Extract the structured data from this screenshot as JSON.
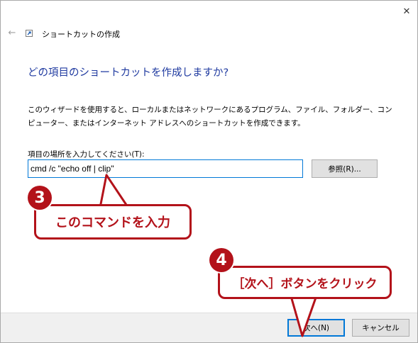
{
  "window": {
    "title": "ショートカットの作成",
    "close_glyph": "✕",
    "back_glyph": "←"
  },
  "wizard": {
    "heading": "どの項目のショートカットを作成しますか?",
    "description": "このウィザードを使用すると、ローカルまたはネットワークにあるプログラム、ファイル、フォルダー、コンピューター、またはインターネット アドレスへのショートカットを作成できます。",
    "field_label": "項目の場所を入力してください(T):",
    "location_value": "cmd /c \"echo off | clip\"",
    "browse_label": "参照(R)..."
  },
  "footer": {
    "next_label": "次へ(N)",
    "cancel_label": "キャンセル"
  },
  "annotations": {
    "step3_number": "3",
    "step3_text": "このコマンドを入力",
    "step4_number": "4",
    "step4_text": "［次へ］ボタンをクリック",
    "color": "#b3121a"
  }
}
